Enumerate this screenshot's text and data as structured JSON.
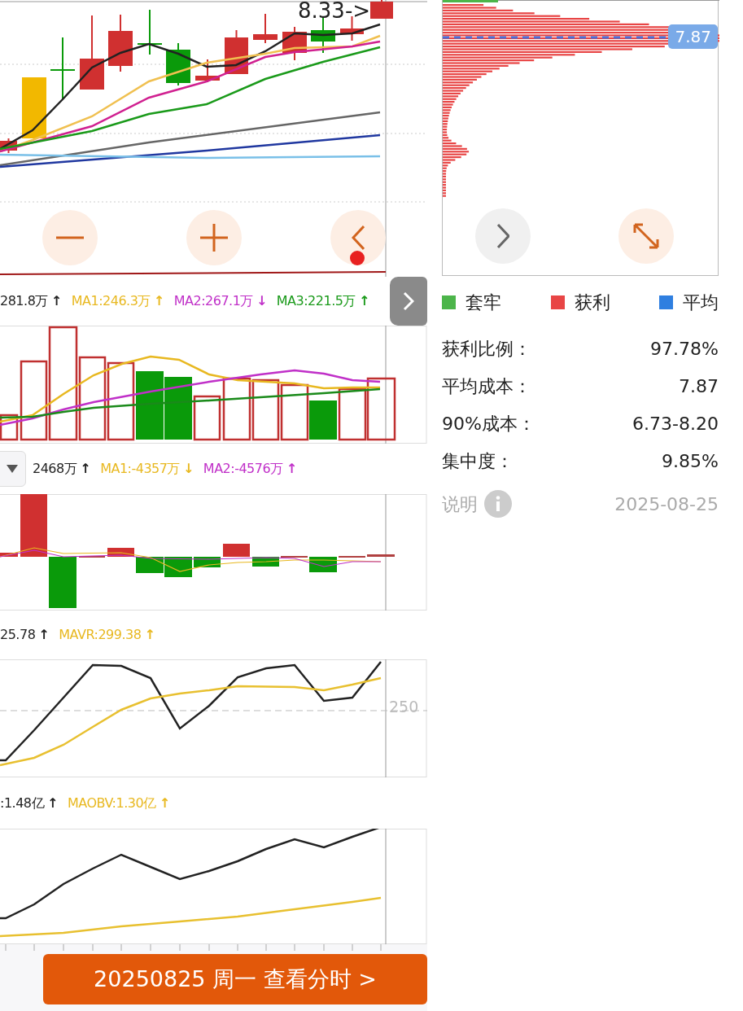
{
  "price_chart": {
    "last_price_label": "8.33->",
    "buttons": [
      {
        "kind": "zoom_out",
        "notification_dot": false
      },
      {
        "kind": "zoom_in",
        "notification_dot": false
      },
      {
        "kind": "back",
        "notification_dot": true
      }
    ]
  },
  "volume_indicator": {
    "items": [
      {
        "text": "281.8万",
        "arrow": "↑",
        "color": "#222222"
      },
      {
        "text": "MA1:246.3万",
        "arrow": "↑",
        "color": "#e8b820"
      },
      {
        "text": "MA2:267.1万",
        "arrow": "↓",
        "color": "#c030c8"
      },
      {
        "text": "MA3:221.5万",
        "arrow": "↑",
        "color": "#1a9a1a"
      }
    ]
  },
  "fund_flow_indicator": {
    "items": [
      {
        "text": "2468万",
        "arrow": "↑",
        "color": "#222222"
      },
      {
        "text": "MA1:-4357万",
        "arrow": "↓",
        "color": "#e8b820"
      },
      {
        "text": "MA2:-4576万",
        "arrow": "↑",
        "color": "#c030c8"
      }
    ]
  },
  "avr_indicator": {
    "items": [
      {
        "text": "25.78",
        "arrow": "↑",
        "color": "#222222"
      },
      {
        "text": "MAVR:299.38",
        "arrow": "↑",
        "color": "#e8b820"
      }
    ],
    "axis_label": "250"
  },
  "obv_indicator": {
    "items": [
      {
        "text": ":1.48亿",
        "arrow": "↑",
        "color": "#222222"
      },
      {
        "text": "MAOBV:1.30亿",
        "arrow": "↑",
        "color": "#e8b820"
      }
    ]
  },
  "date_button": "20250825 周一 查看分时 >",
  "chip_chart": {
    "avg_cost_label": "7.87"
  },
  "legend": [
    {
      "label": "套牢",
      "color": "#4cb54a"
    },
    {
      "label": "获利",
      "color": "#e84545"
    },
    {
      "label": "平均",
      "color": "#2f7fe0"
    }
  ],
  "stats": [
    {
      "label": "获利比例：",
      "value": "97.78%"
    },
    {
      "label": "平均成本：",
      "value": "7.87"
    },
    {
      "label": "90%成本：",
      "value": "6.73-8.20"
    },
    {
      "label": "集中度：",
      "value": "9.85%"
    }
  ],
  "footer": {
    "note_label": "说明",
    "date": "2025-08-25"
  }
}
